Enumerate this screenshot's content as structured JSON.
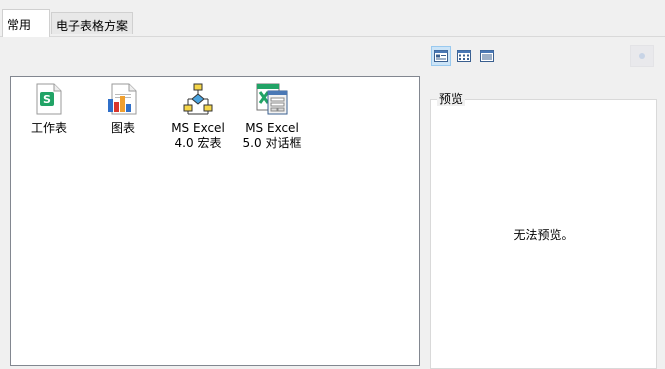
{
  "tabs": [
    {
      "label": "常用",
      "active": true
    },
    {
      "label": "电子表格方案",
      "active": false
    }
  ],
  "view_buttons": [
    {
      "name": "large-icons",
      "selected": true
    },
    {
      "name": "small-icons",
      "selected": false
    },
    {
      "name": "list",
      "selected": false
    }
  ],
  "templates": [
    {
      "label_line1": "工作表",
      "label_line2": "",
      "icon": "worksheet-icon"
    },
    {
      "label_line1": "图表",
      "label_line2": "",
      "icon": "chart-icon"
    },
    {
      "label_line1": "MS Excel",
      "label_line2": "4.0 宏表",
      "icon": "macro-sheet-icon"
    },
    {
      "label_line1": "MS Excel",
      "label_line2": "5.0 对话框",
      "icon": "dialog-sheet-icon"
    }
  ],
  "preview": {
    "legend": "预览",
    "message": "无法预览。"
  },
  "colors": {
    "selected_bg": "#cce4f7",
    "worksheet_green": "#21a366",
    "chart_blue": "#2f6fc9",
    "chart_red": "#d9352b",
    "chart_orange": "#f0a030"
  }
}
